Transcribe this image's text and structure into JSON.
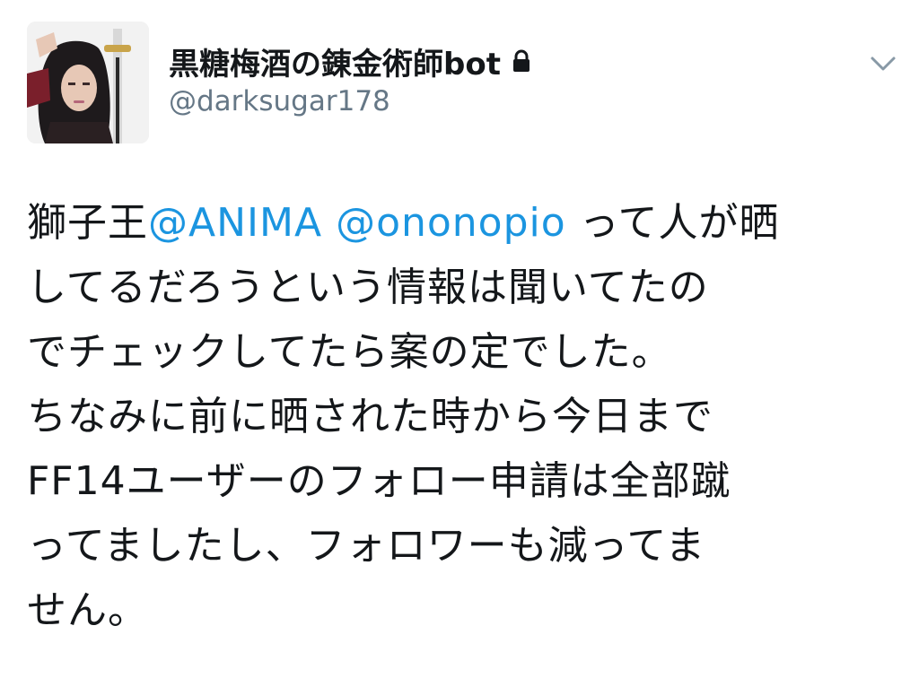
{
  "tweet": {
    "author": {
      "display_name": "黒糖梅酒の錬金術師bot",
      "handle": "@darksugar178",
      "protected": true
    },
    "icons": {
      "lock": "lock-icon",
      "menu": "chevron-down-icon"
    },
    "body": {
      "line1_prefix": "獅子王",
      "mention1": "@ANIMA",
      "mention2": "@ononopio",
      "line1_suffix": " って人が晒",
      "line2": "してるだろうという情報は聞いてたの",
      "line3": "でチェックしてたら案の定でした。",
      "line4": "ちなみに前に晒された時から今日まで",
      "line5": "FF14ユーザーのフォロー申請は全部蹴",
      "line6": "ってましたし、フォロワーも減ってま",
      "line7": "せん。"
    },
    "colors": {
      "text": "#14171a",
      "secondary": "#657786",
      "link": "#1b95e0"
    }
  }
}
